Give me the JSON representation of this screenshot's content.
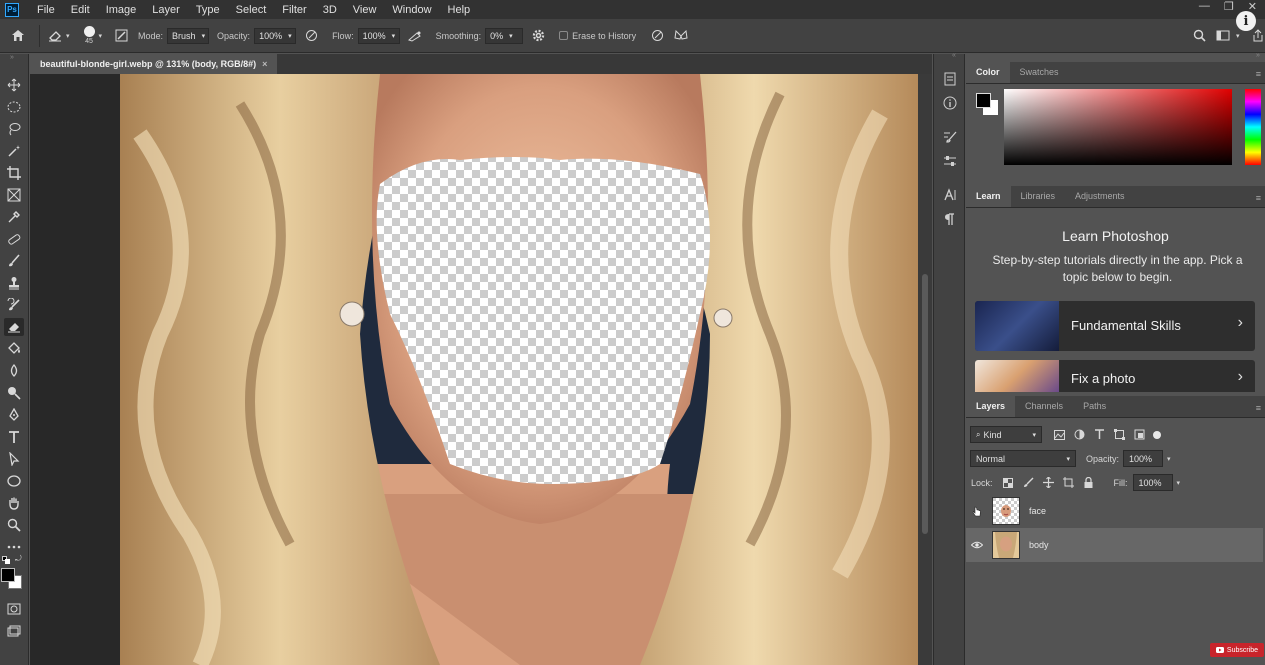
{
  "app": {
    "logo": "Ps"
  },
  "menu": [
    "File",
    "Edit",
    "Image",
    "Layer",
    "Type",
    "Select",
    "Filter",
    "3D",
    "View",
    "Window",
    "Help"
  ],
  "window_controls": [
    "—",
    "❐",
    "✕"
  ],
  "options_bar": {
    "brush_size": "45",
    "mode_label": "Mode:",
    "mode_value": "Brush",
    "opacity_label": "Opacity:",
    "opacity_value": "100%",
    "flow_label": "Flow:",
    "flow_value": "100%",
    "smoothing_label": "Smoothing:",
    "smoothing_value": "0%",
    "erase_history_label": "Erase to History"
  },
  "document": {
    "tab_title": "beautiful-blonde-girl.webp @ 131% (body, RGB/8#)",
    "tab_close": "×"
  },
  "color_panel": {
    "tabs": [
      "Color",
      "Swatches"
    ],
    "active_tab": "Color",
    "foreground": "#000000",
    "background": "#ffffff",
    "hue": "#ff0000"
  },
  "learn_panel": {
    "tabs": [
      "Learn",
      "Libraries",
      "Adjustments"
    ],
    "title": "Learn Photoshop",
    "description": "Step-by-step tutorials directly in the app. Pick a topic below to begin.",
    "cards": [
      {
        "label": "Fundamental Skills"
      },
      {
        "label": "Fix a photo"
      }
    ]
  },
  "layers_panel": {
    "tabs": [
      "Layers",
      "Channels",
      "Paths"
    ],
    "kind_label": "Kind",
    "blend_mode": "Normal",
    "opacity_label": "Opacity:",
    "opacity_value": "100%",
    "lock_label": "Lock:",
    "fill_label": "Fill:",
    "fill_value": "100%",
    "layers": [
      {
        "name": "face",
        "visible": false
      },
      {
        "name": "body",
        "visible": true,
        "selected": true
      }
    ]
  },
  "overlay": {
    "subscribe_label": "Subscribe",
    "info_glyph": "i"
  }
}
